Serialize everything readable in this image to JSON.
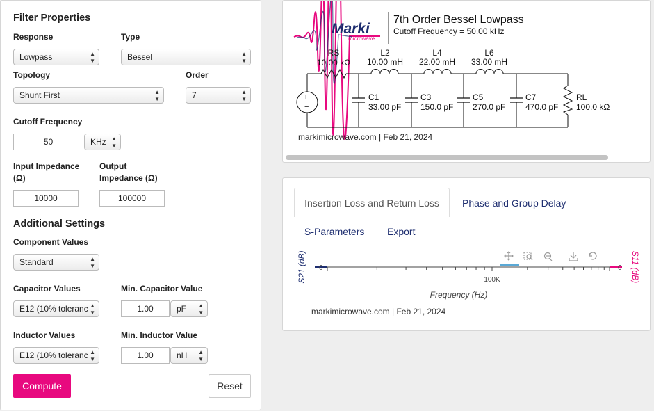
{
  "filter": {
    "title": "Filter Properties",
    "response_label": "Response",
    "response_value": "Lowpass",
    "type_label": "Type",
    "type_value": "Bessel",
    "topology_label": "Topology",
    "topology_value": "Shunt First",
    "order_label": "Order",
    "order_value": "7",
    "cutoff_label": "Cutoff Frequency",
    "cutoff_value": "50",
    "cutoff_unit": "KHz",
    "input_imp_label_1": "Input Impedance",
    "input_imp_label_2": "(Ω)",
    "input_imp_value": "10000",
    "output_imp_label_1": "Output",
    "output_imp_label_2": "Impedance (Ω)",
    "output_imp_value": "100000"
  },
  "additional": {
    "title": "Additional Settings",
    "component_values_label": "Component Values",
    "component_values_value": "Standard",
    "cap_values_label": "Capacitor Values",
    "cap_values_value": "E12 (10% toleranc",
    "min_cap_label": "Min. Capacitor Value",
    "min_cap_value": "1.00",
    "min_cap_unit": "pF",
    "ind_values_label": "Inductor Values",
    "ind_values_value": "E12 (10% toleranc",
    "min_ind_label": "Min. Inductor Value",
    "min_ind_value": "1.00",
    "min_ind_unit": "nH",
    "compute_label": "Compute",
    "reset_label": "Reset"
  },
  "schematic": {
    "logo_text": "Marki",
    "logo_sub": "microwave",
    "title": "7th Order Bessel Lowpass",
    "subtitle": "Cutoff Frequency = 50.00 kHz",
    "footer": "markimicrowave.com | Feb 21, 2024",
    "source_plus": "+",
    "source_minus": "−",
    "rs_name": "RS",
    "rs_value": "10.00 kΩ",
    "inductors": [
      {
        "name": "L2",
        "value": "10.00 mH"
      },
      {
        "name": "L4",
        "value": "22.00 mH"
      },
      {
        "name": "L6",
        "value": "33.00 mH"
      }
    ],
    "capacitors": [
      {
        "name": "C1",
        "value": "33.00 pF"
      },
      {
        "name": "C3",
        "value": "150.0 pF"
      },
      {
        "name": "C5",
        "value": "270.0 pF"
      },
      {
        "name": "C7",
        "value": "470.0 pF"
      }
    ],
    "rl_name": "RL",
    "rl_value": "100.0 kΩ",
    "colors": {
      "brand": "#e8097f",
      "navy": "#1d2d6f"
    }
  },
  "tabs": {
    "insertion": "Insertion Loss and Return Loss",
    "phase": "Phase and Group Delay",
    "sparams": "S-Parameters",
    "export": "Export"
  },
  "chart": {
    "footer": "markimicrowave.com | Feb 21, 2024"
  },
  "chart_data": {
    "type": "line",
    "xlabel": "Frequency (Hz)",
    "ylabel_left": "S21 (dB)",
    "ylabel_right": "S11 (dB)",
    "x_ticks": [
      "100K"
    ],
    "y_ticks_left": [
      "0"
    ],
    "y_ticks_right": [
      "0"
    ],
    "x_scale": "log",
    "series": [
      {
        "name": "S21 (dB)",
        "color": "#1d2d6f"
      },
      {
        "name": "S11 (dB)",
        "color": "#e8097f"
      }
    ]
  }
}
